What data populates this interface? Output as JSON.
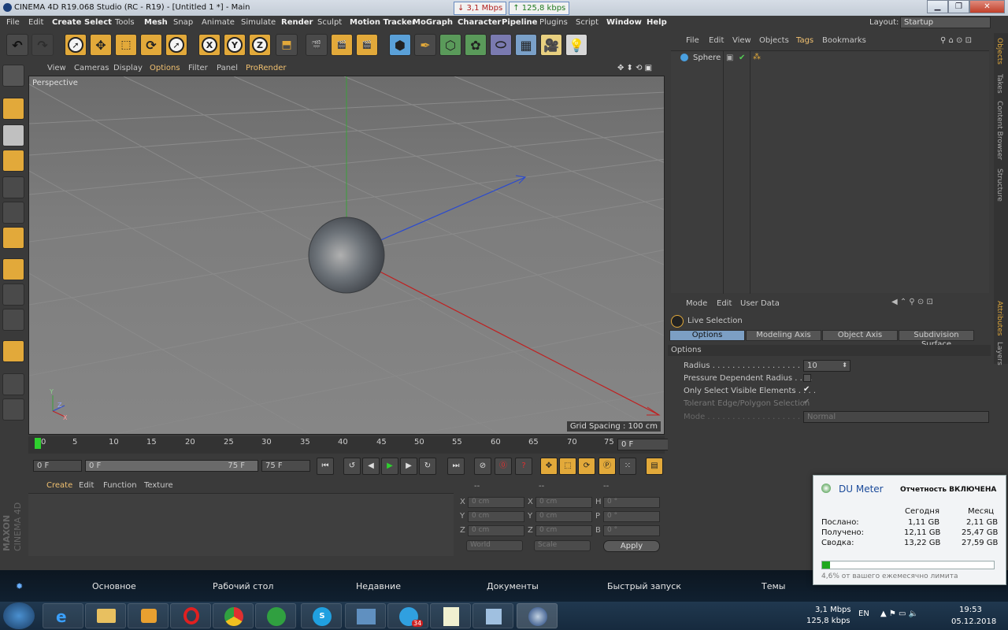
{
  "window": {
    "title": "CINEMA 4D R19.068 Studio (RC - R19) - [Untitled 1 *] - Main",
    "min": "▁",
    "max": "❐",
    "close": "✕"
  },
  "netspeed": {
    "down": "↓ 3,1 Mbps",
    "up": "↑ 125,8 kbps"
  },
  "menubar": {
    "items": [
      "File",
      "Edit",
      "Create",
      "Select",
      "Tools",
      "Mesh",
      "Snap",
      "Animate",
      "Simulate",
      "Render",
      "Sculpt",
      "Motion Tracker",
      "MoGraph",
      "Character",
      "Pipeline",
      "Plugins",
      "Script",
      "Window",
      "Help"
    ],
    "layout_label": "Layout:",
    "layout_value": "Startup"
  },
  "toolbar": {
    "x_label": "X",
    "y_label": "Y",
    "z_label": "Z"
  },
  "viewport": {
    "menu": [
      "View",
      "Cameras",
      "Display",
      "Options",
      "Filter",
      "Panel",
      "ProRender"
    ],
    "label": "Perspective",
    "grid_spacing": "Grid Spacing : 100 cm",
    "axis_y": "Y",
    "axis_z": "Z",
    "axis_x": "X"
  },
  "timeline": {
    "ticks": [
      "0",
      "5",
      "10",
      "15",
      "20",
      "25",
      "30",
      "35",
      "40",
      "45",
      "50",
      "55",
      "60",
      "65",
      "70",
      "75"
    ],
    "current": "0 F",
    "start_field": "0 F",
    "slider_start": "0 F",
    "slider_end": "75 F",
    "end_field": "75 F"
  },
  "material_manager": {
    "menu": [
      "Create",
      "Edit",
      "Function",
      "Texture"
    ]
  },
  "coordinates": {
    "headers": [
      "--",
      "--",
      "--"
    ],
    "rows": [
      {
        "a": "X",
        "av": "0 cm",
        "b": "X",
        "bv": "0 cm",
        "c": "H",
        "cv": "0 °"
      },
      {
        "a": "Y",
        "av": "0 cm",
        "b": "Y",
        "bv": "0 cm",
        "c": "P",
        "cv": "0 °"
      },
      {
        "a": "Z",
        "av": "0 cm",
        "b": "Z",
        "bv": "0 cm",
        "c": "B",
        "cv": "0 °"
      }
    ],
    "world": "World",
    "scale": "Scale",
    "apply": "Apply"
  },
  "object_manager": {
    "menu": [
      "File",
      "Edit",
      "View",
      "Objects",
      "Tags",
      "Bookmarks"
    ],
    "object": "Sphere"
  },
  "attributes": {
    "menu": [
      "Mode",
      "Edit",
      "User Data"
    ],
    "tool": "Live Selection",
    "tabs": [
      "Options",
      "Modeling Axis",
      "Object Axis",
      "Subdivision Surface"
    ],
    "section": "Options",
    "radius_label": "Radius . . . . . . . . . . . . . . . . . . . . .",
    "radius_value": "10",
    "pressure_label": "Pressure Dependent Radius . . . .",
    "visible_label": "Only Select Visible Elements . . . .",
    "tolerant_label": "Tolerant Edge/Polygon Selection",
    "mode_label": "Mode . . . . . . . . . . . . . . . . . . . . . . .",
    "mode_value": "Normal",
    "check": "✔"
  },
  "side_tabs": [
    "Objects",
    "Takes",
    "Content Browser",
    "Structure",
    "Attributes",
    "Layers"
  ],
  "maxon": {
    "brand": "MAXON",
    "product": "CINEMA 4D"
  },
  "taskbar_upper": {
    "items": [
      "Основное",
      "Рабочий стол",
      "Недавние",
      "Документы",
      "Быстрый запуск",
      "Темы"
    ]
  },
  "tray": {
    "down": "3,1 Mbps",
    "up": "125,8 kbps",
    "lang": "EN",
    "time": "19:53",
    "date": "05.12.2018",
    "badge": "34"
  },
  "du_meter": {
    "title": "DU Meter",
    "status": "Отчетность ВКЛЮЧЕНА",
    "col_today": "Сегодня",
    "col_month": "Месяц",
    "rows": [
      {
        "label": "Послано:",
        "today": "1,11 GB",
        "month": "2,11 GB"
      },
      {
        "label": "Получено:",
        "today": "12,11 GB",
        "month": "25,47 GB"
      },
      {
        "label": "Сводка:",
        "today": "13,22 GB",
        "month": "27,59 GB"
      }
    ],
    "progress_fraction": 0.046,
    "footer": "4,6% от вашего ежемесячно лимита"
  }
}
